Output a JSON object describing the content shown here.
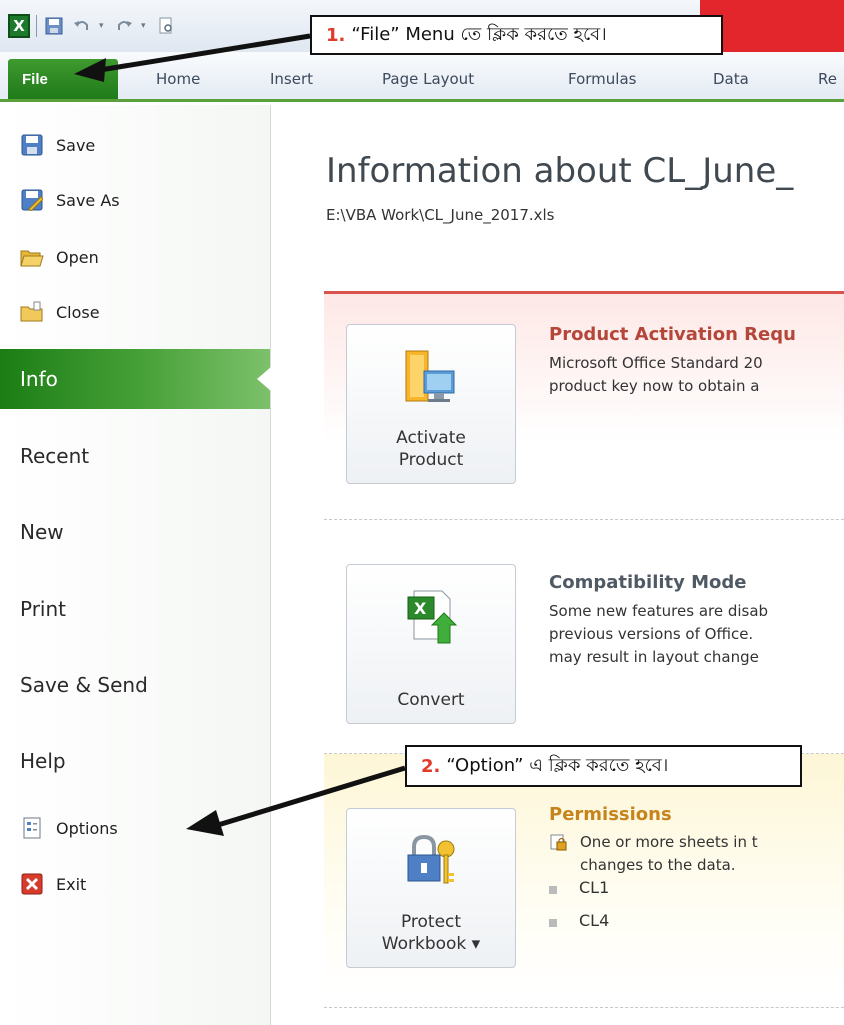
{
  "titlebar": {
    "logo_letter": "X"
  },
  "tabs": [
    {
      "label": "File"
    },
    {
      "label": "Home"
    },
    {
      "label": "Insert"
    },
    {
      "label": "Page Layout"
    },
    {
      "label": "Formulas"
    },
    {
      "label": "Data"
    },
    {
      "label": "Re"
    }
  ],
  "nav": {
    "save": "Save",
    "save_as": "Save As",
    "open": "Open",
    "close": "Close",
    "info": "Info",
    "recent": "Recent",
    "new": "New",
    "print": "Print",
    "save_send": "Save & Send",
    "help": "Help",
    "options": "Options",
    "exit": "Exit"
  },
  "main": {
    "title": "Information about CL_June_",
    "path": "E:\\VBA Work\\CL_June_2017.xls",
    "activation": {
      "button_line1": "Activate",
      "button_line2": "Product",
      "heading": "Product Activation Requ",
      "line1": "Microsoft Office Standard 20",
      "line2": "product key now to obtain a"
    },
    "compat": {
      "button": "Convert",
      "heading": "Compatibility Mode",
      "line1": "Some new features are disab",
      "line2": "previous versions of Office.",
      "line3": "may result in layout change"
    },
    "permissions": {
      "button_line1": "Protect",
      "button_line2": "Workbook ▾",
      "heading": "Permissions",
      "line1": "One or more sheets in t",
      "line2": "changes to the data.",
      "sheets": [
        "CL1",
        "CL4"
      ]
    }
  },
  "callouts": {
    "one_num": "1.",
    "one_text": "“File” Menu তে ক্লিক করতে হবে।",
    "two_num": "2.",
    "two_text": "“Option” এ ক্লিক করতে হবে।"
  },
  "colors": {
    "file_tab": "#2a8a22",
    "info_selected": "#2e8f24",
    "activation_heading": "#b5473a",
    "compat_heading": "#505a64",
    "perm_heading": "#c8841c",
    "callout_number": "#e23a2a"
  }
}
